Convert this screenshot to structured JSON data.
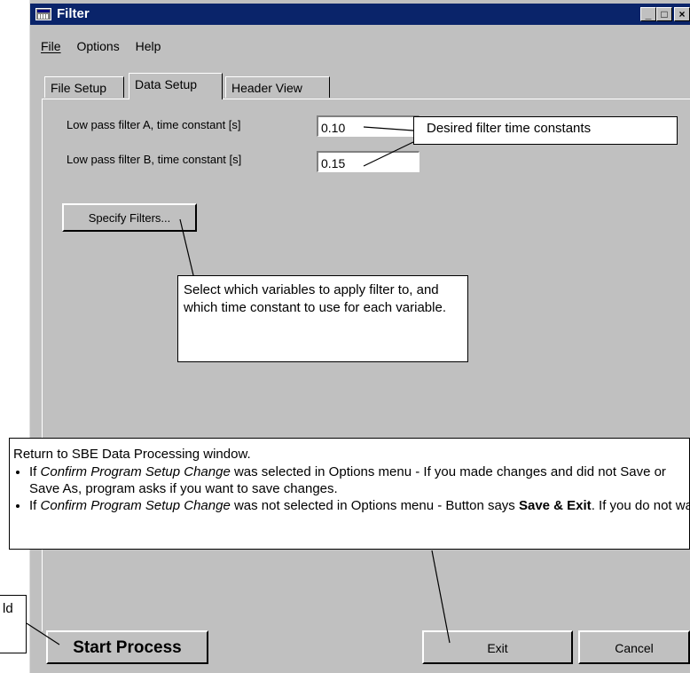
{
  "window": {
    "title": "Filter"
  },
  "menu": {
    "file": "File",
    "options": "Options",
    "help": "Help"
  },
  "tabs": [
    "File Setup",
    "Data Setup",
    "Header View"
  ],
  "fields": [
    {
      "label": "Low pass filter A, time constant [s]",
      "value": "0.10"
    },
    {
      "label": "Low pass filter B, time constant [s]",
      "value": "0.15"
    }
  ],
  "buttons": {
    "specify_filters": "Specify Filters...",
    "start_process": "Start Process",
    "exit": "Exit",
    "cancel": "Cancel"
  },
  "callouts": {
    "time_constants": "Desired filter time constants",
    "specify": "Select which variables to apply filter to, and which time constant to use for each variable.",
    "return_title": "Return to SBE Data Processing window.",
    "bullet1_a": "If ",
    "bullet1_em": "Confirm Program Setup Change",
    "bullet1_b": " was selected in Options menu - If you made changes and did not Save or Save As, program asks if you want to save changes.",
    "bullet2_a": "If ",
    "bullet2_em": "Confirm Program Setup Change",
    "bullet2_b": " was not selected in Options menu - Button says ",
    "bullet2_strong": "Save & Exit",
    "bullet2_c": ". If you do not want to save changes, use Cancel button to exit.",
    "left_fragment": "ld"
  }
}
